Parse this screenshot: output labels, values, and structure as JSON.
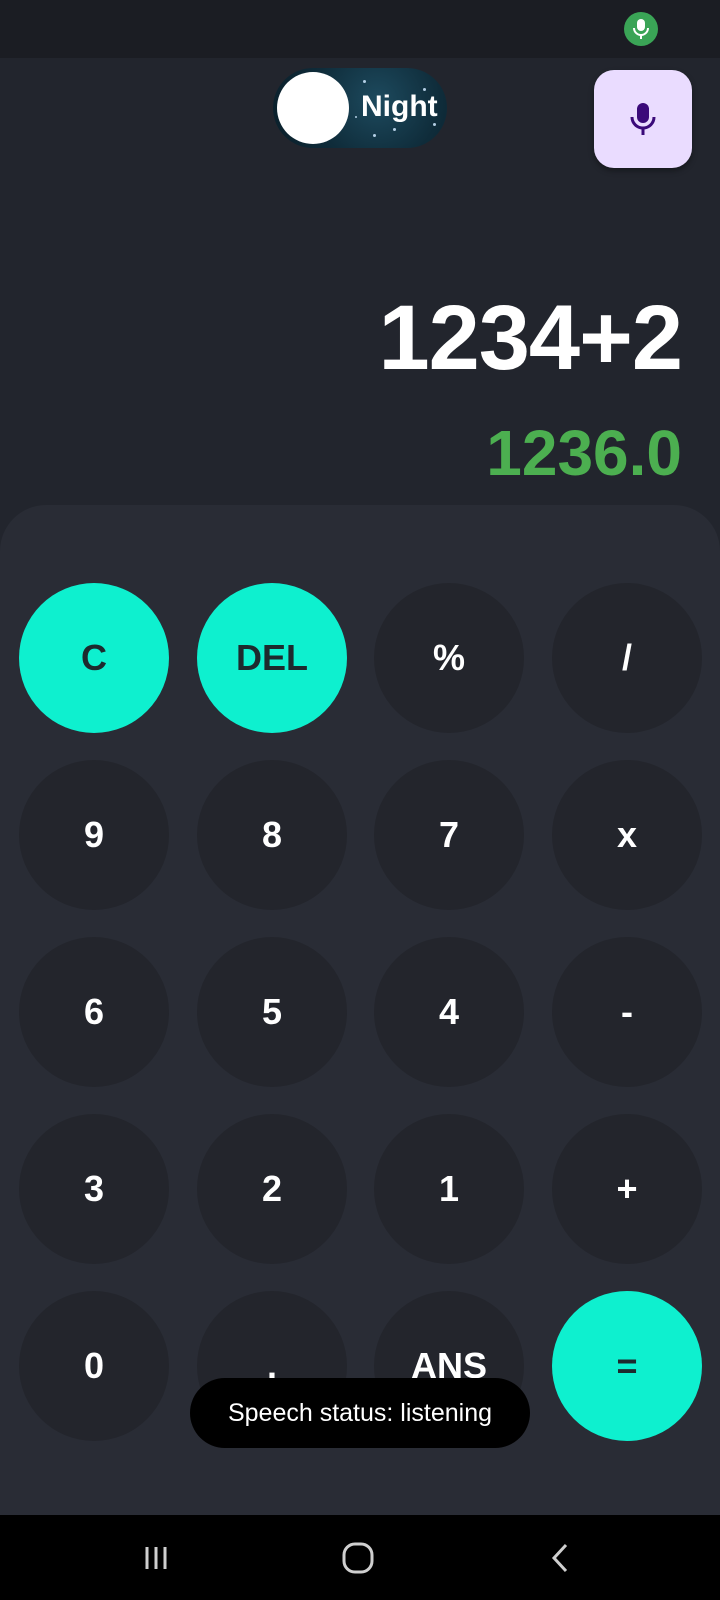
{
  "status_bar": {
    "indicator_icon": "mic-icon",
    "indicator_color": "#3aa456"
  },
  "theme_toggle": {
    "label": "Night",
    "state": "night"
  },
  "voice_button": {
    "icon": "mic-icon",
    "color": "#eadcff"
  },
  "display": {
    "expression": "1234+2",
    "result": "1236.0",
    "result_color": "#4caf50"
  },
  "keypad": {
    "accent_color": "#0ef0cf",
    "keys": {
      "clear": "C",
      "delete": "DEL",
      "percent": "%",
      "divide": "/",
      "nine": "9",
      "eight": "8",
      "seven": "7",
      "multiply": "x",
      "six": "6",
      "five": "5",
      "four": "4",
      "minus": "-",
      "three": "3",
      "two": "2",
      "one": "1",
      "plus": "+",
      "zero": "0",
      "decimal": ".",
      "answer": "ANS",
      "equals": "="
    }
  },
  "toast": {
    "text": "Speech status: listening"
  },
  "navigation": {
    "recent_icon": "recent-apps-icon",
    "home_icon": "home-icon",
    "back_icon": "back-icon"
  }
}
